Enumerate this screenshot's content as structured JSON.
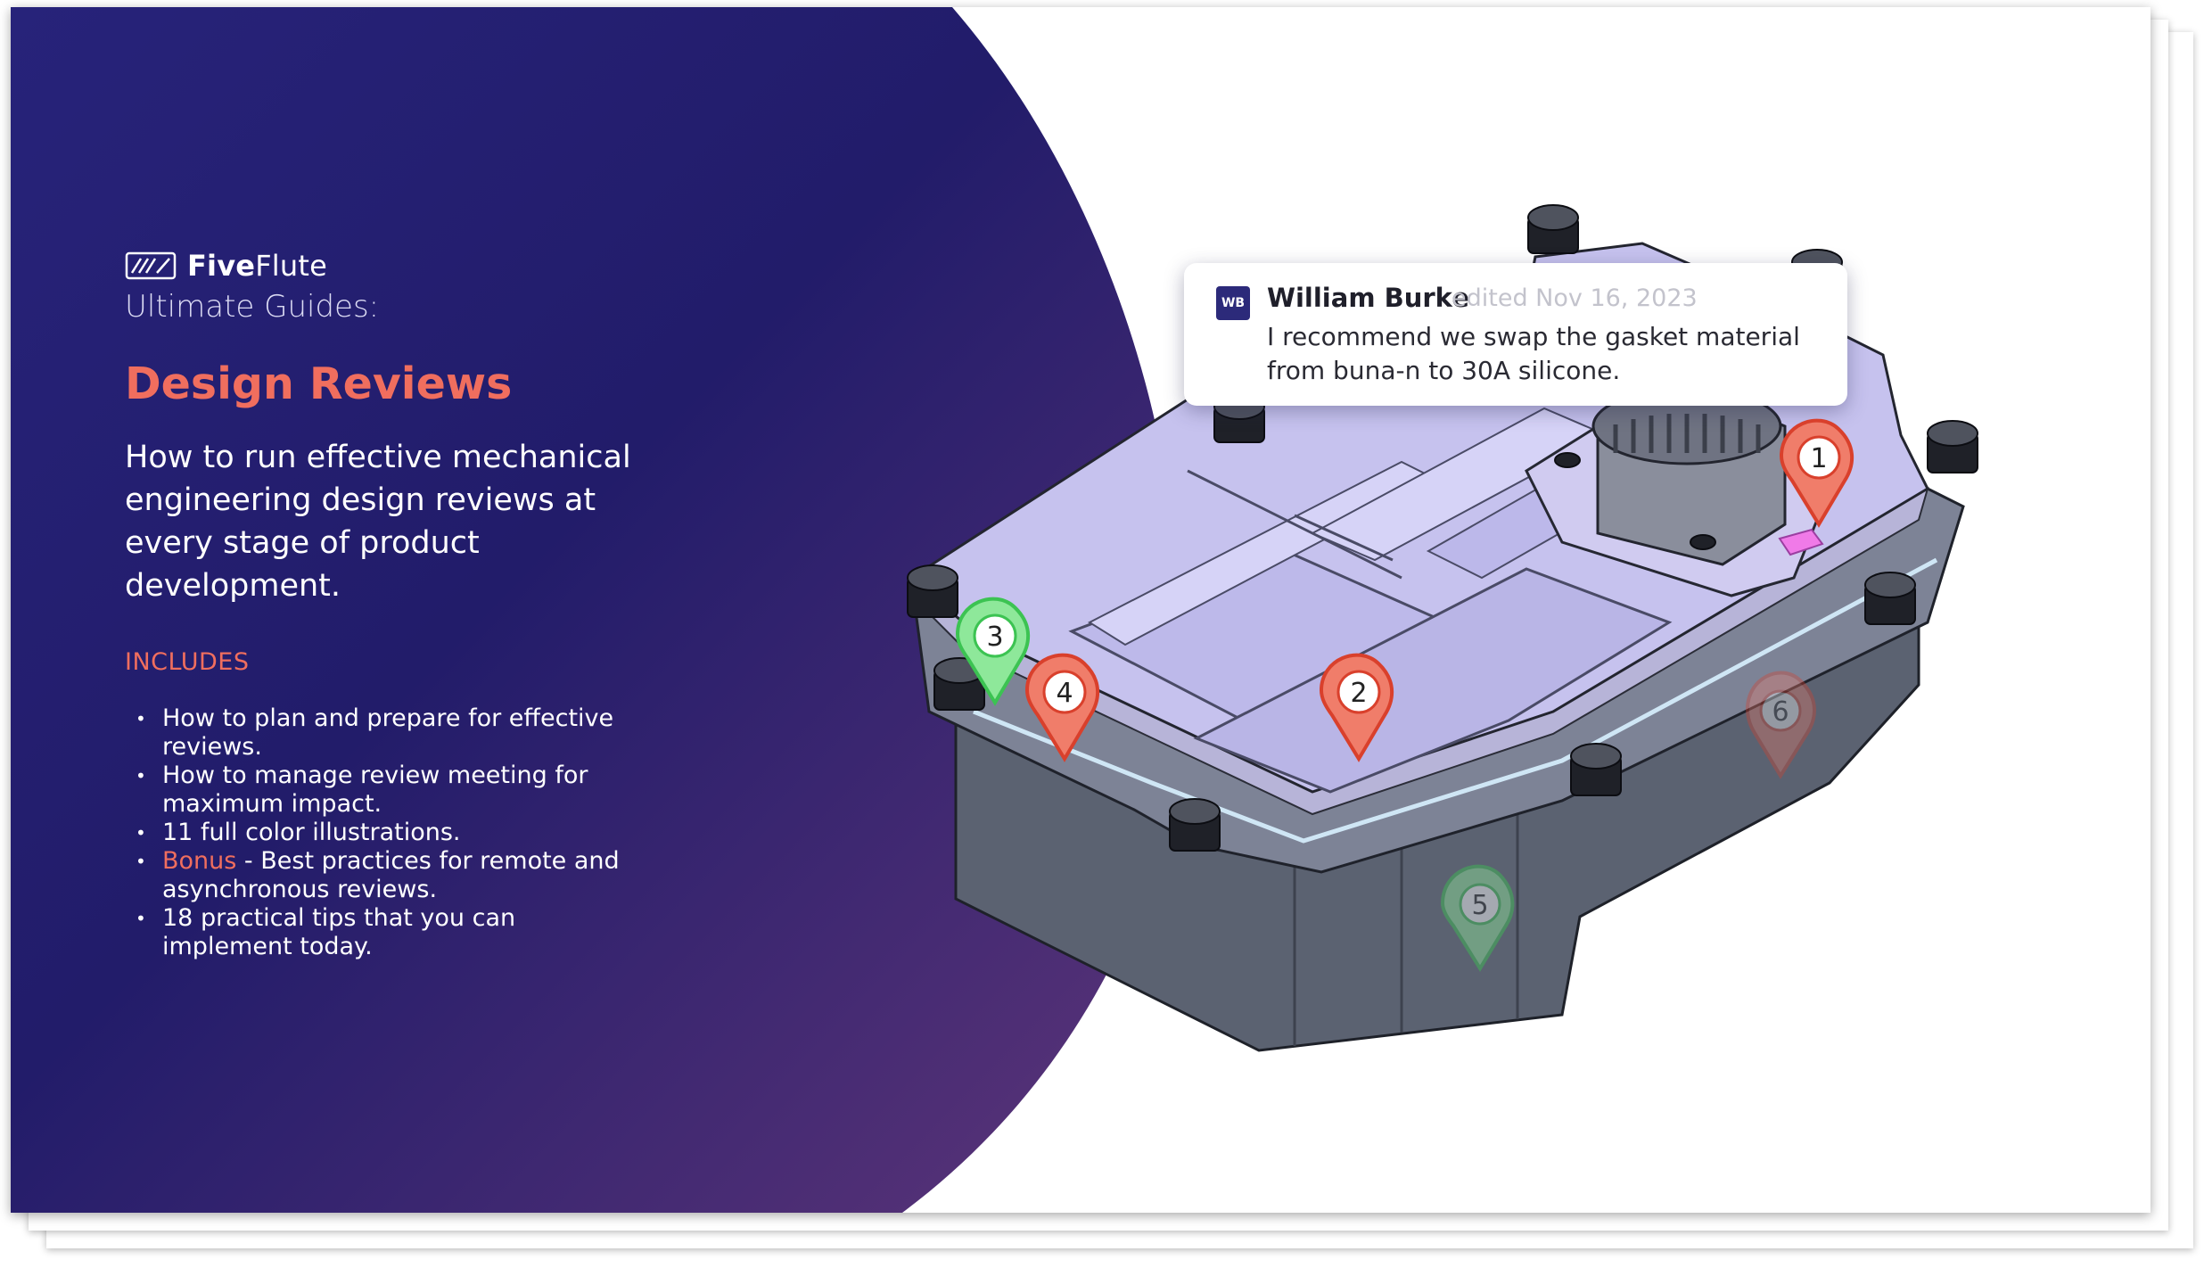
{
  "brand": {
    "logo_icon": "fiveflute-logo-icon",
    "name_bold": "Five",
    "name_light": "Flute"
  },
  "guide_label": "Ultimate Guides:",
  "title": "Design Reviews",
  "subtitle": "How to run effective mechanical engineering design reviews at every stage of product development.",
  "includes_heading": "INCLUDES",
  "includes": [
    {
      "text": "How to plan and prepare for effective reviews."
    },
    {
      "text": "How to manage review meeting for maximum impact."
    },
    {
      "text": "11 full color illustrations."
    },
    {
      "highlight": "Bonus",
      "text": " - Best practices for remote and asynchronous reviews."
    },
    {
      "text": "18 practical tips that you can implement today."
    }
  ],
  "comment": {
    "avatar_initials": "WB",
    "author": "William Burke",
    "date": "edited Nov 16, 2023",
    "body": "I recommend we swap the gasket material from buna-n to 30A silicone."
  },
  "pins": [
    {
      "label": "1",
      "status": "open",
      "opacity": 1
    },
    {
      "label": "2",
      "status": "open",
      "opacity": 1
    },
    {
      "label": "3",
      "status": "resolved",
      "opacity": 1
    },
    {
      "label": "4",
      "status": "open",
      "opacity": 1
    },
    {
      "label": "5",
      "status": "resolved",
      "opacity": 0.45
    },
    {
      "label": "6",
      "status": "open",
      "opacity": 0.35
    }
  ],
  "colors": {
    "panel_top": "#25206e",
    "panel_bottom": "#5a3479",
    "accent": "#f06e5e",
    "pin_open": "#f07d6a",
    "pin_open_stroke": "#d9402c",
    "pin_resolved": "#8ee89a",
    "pin_resolved_stroke": "#3cc352",
    "part_top": "#c6c2ee",
    "part_side": "#575e6e"
  }
}
